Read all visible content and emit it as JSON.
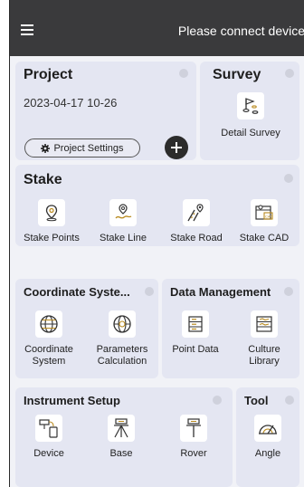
{
  "topbar": {
    "status": "Please connect device"
  },
  "project": {
    "title": "Project",
    "datetime": "2023-04-17 10-26",
    "settings_label": "Project Settings"
  },
  "survey": {
    "title": "Survey",
    "items": [
      {
        "label": "Detail Survey",
        "icon": "flag-icon"
      }
    ]
  },
  "stake": {
    "title": "Stake",
    "items": [
      {
        "label": "Stake Points",
        "icon": "location-pin-icon"
      },
      {
        "label": "Stake Line",
        "icon": "pin-line-icon"
      },
      {
        "label": "Stake Road",
        "icon": "road-icon"
      },
      {
        "label": "Stake CAD",
        "icon": "cad-icon"
      }
    ]
  },
  "coordinate": {
    "title": "Coordinate Syste...",
    "items": [
      {
        "line1": "Coordinate",
        "line2": "System",
        "icon": "globe-icon"
      },
      {
        "line1": "Parameters",
        "line2": "Calculation",
        "icon": "globe-calc-icon"
      }
    ]
  },
  "data_management": {
    "title": "Data Management",
    "items": [
      {
        "line1": "Point Data",
        "line2": "",
        "icon": "database-icon"
      },
      {
        "line1": "Culture",
        "line2": "Library",
        "icon": "library-icon"
      }
    ]
  },
  "instrument": {
    "title": "Instrument Setup",
    "items": [
      {
        "label": "Device",
        "icon": "device-icon"
      },
      {
        "label": "Base",
        "icon": "tripod-icon"
      },
      {
        "label": "Rover",
        "icon": "rover-icon"
      }
    ]
  },
  "tool": {
    "title": "Tool",
    "items": [
      {
        "label": "Angle",
        "icon": "angle-icon"
      }
    ]
  },
  "colors": {
    "topbar": "#3a3a3c",
    "card": "#e4e6f2",
    "background": "#f1f2f7",
    "accent": "#b98a1e"
  }
}
